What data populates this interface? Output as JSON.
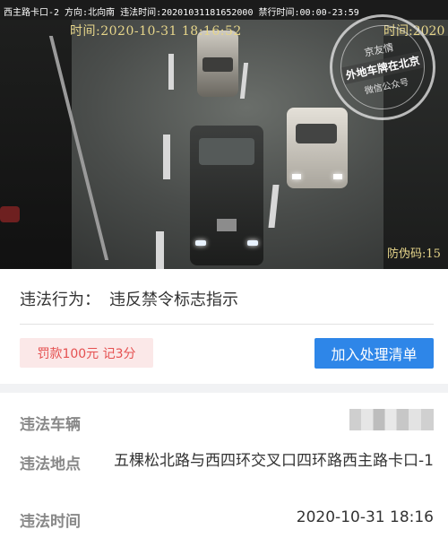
{
  "photo": {
    "caption": "西主路卡口-2 方向:北向南 违法时间:20201031181652000 禁行时间:00:00-23:59",
    "timestamp": "时间:2020-10-31 18:16:52",
    "timestamp_right": "时间:2020",
    "anti_fake": "防伪码:15",
    "watermark": {
      "line1": "京友情",
      "line2": "外地车牌在北京",
      "line3": "微信公众号"
    }
  },
  "violation": {
    "behavior_label": "违法行为：",
    "behavior_value": "违反禁令标志指示",
    "fine_badge": "罚款100元 记3分",
    "add_button": "加入处理清单"
  },
  "details": {
    "vehicle_label": "违法车辆",
    "location_label": "违法地点",
    "location_value": "五棵松北路与西四环交叉口四环路西主路卡口-1",
    "time_label": "违法时间",
    "time_value": "2020-10-31 18:16"
  },
  "colors": {
    "accent": "#2e86e8",
    "fine_text": "#e55050",
    "fine_bg": "#fbe8e8"
  }
}
